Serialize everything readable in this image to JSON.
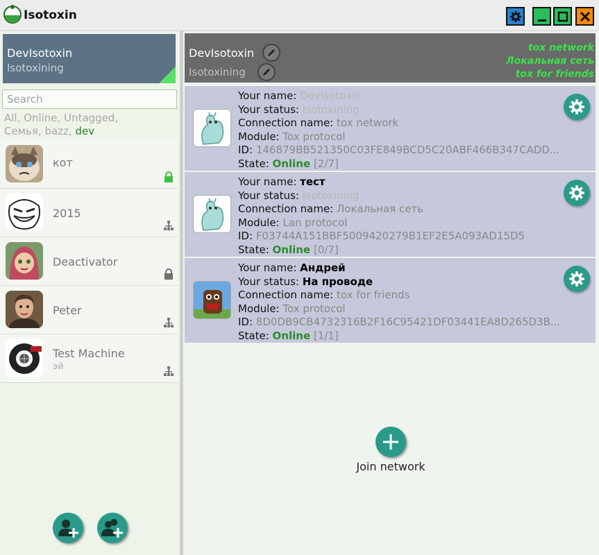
{
  "app": {
    "title": "Isotoxin"
  },
  "profile": {
    "name": "DevIsotoxin",
    "status": "Isotoxining"
  },
  "search": {
    "placeholder": "Search"
  },
  "tags": [
    "All",
    "Online",
    "Untagged",
    "Семья",
    "bazz",
    "dev"
  ],
  "active_tag": "dev",
  "contacts": [
    {
      "name": "кот",
      "status": "",
      "icon": "lock-icon",
      "icon_color": "#3cc040"
    },
    {
      "name": "2015",
      "status": "",
      "icon": "network-icon"
    },
    {
      "name": "Deactivator",
      "status": "",
      "icon": "lock-icon",
      "icon_color": "#707070"
    },
    {
      "name": "Peter",
      "status": "",
      "icon": "network-icon"
    },
    {
      "name": "Test Machine",
      "status": "эй",
      "icon": "network-icon"
    }
  ],
  "header": {
    "name": "DevIsotoxin",
    "status": "Isotoxining",
    "networks": [
      "tox network",
      "Локальная сеть",
      "tox for friends"
    ]
  },
  "labels": {
    "your_name": "Your name:",
    "your_status": "Your status:",
    "connection_name": "Connection name:",
    "module": "Module:",
    "id": "ID:",
    "state": "State:"
  },
  "accounts": [
    {
      "your_name": "DevIsotoxin",
      "your_status": "Isotoxining",
      "connection_name": "tox network",
      "module": "Tox protocol",
      "id": "146879BB521350C03FE849BCD5C20ABF466B347CADD...",
      "state": "Online",
      "state_count": "[2/7]"
    },
    {
      "your_name": "тест",
      "your_status": "Isotoxining",
      "connection_name": "Локальная сеть",
      "module": "Lan protocol",
      "id": "F03744A151BBF5009420279B1EF2E5A093AD15D5",
      "state": "Online",
      "state_count": "[0/7]"
    },
    {
      "your_name": "Андрей",
      "your_status": "На проводе",
      "connection_name": "tox for friends",
      "module": "Tox protocol",
      "id": "8D0DB9CB4732316B2F16C95421DF03441EA8D265D3B...",
      "state": "Online",
      "state_count": "[1/1]"
    }
  ],
  "join": {
    "label": "Join network"
  },
  "colors": {
    "accent": "#2a9a8a",
    "online": "#2e8b2e",
    "network_text": "#3ae04a"
  }
}
